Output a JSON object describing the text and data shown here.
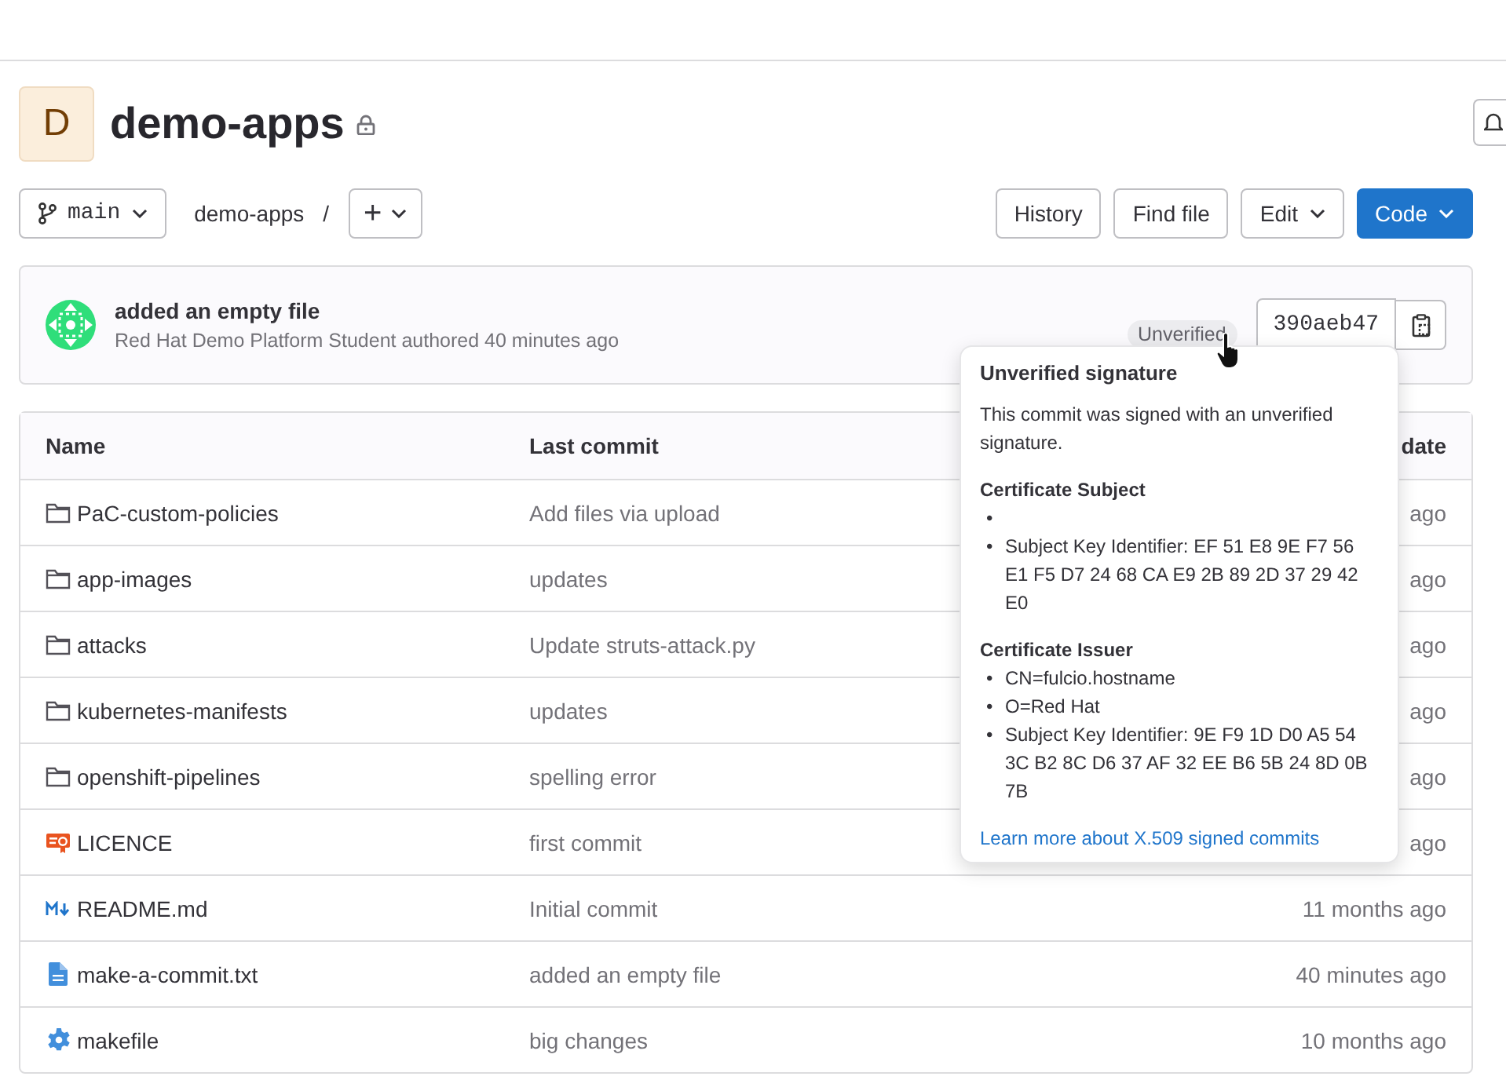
{
  "project": {
    "avatar_letter": "D",
    "name": "demo-apps",
    "private": true
  },
  "toolbar": {
    "branch": "main",
    "breadcrumb": "demo-apps",
    "separator": "/",
    "add": "+",
    "buttons": [
      {
        "label": "History",
        "kind": "plain"
      },
      {
        "label": "Find file",
        "kind": "plain"
      },
      {
        "label": "Edit",
        "kind": "dropdown"
      },
      {
        "label": "Code",
        "kind": "primary"
      }
    ]
  },
  "commit": {
    "title": "added an empty file",
    "meta": "Red Hat Demo Platform Student authored 40 minutes ago",
    "badge": "Unverified",
    "sha": "390aeb47"
  },
  "popover": {
    "title": "Unverified signature",
    "text": "This commit was signed with an unverified signature.",
    "sections": [
      {
        "heading": "Certificate Subject",
        "items": [
          {
            "bullet": "•"
          },
          {
            "bullet": "•",
            "text": "Subject Key Identifier: EF 51 E8 9E F7 56 E1 F5 D7 24 68 CA E9 2B 89 2D 37 29 42 E0"
          }
        ]
      },
      {
        "heading": "Certificate Issuer",
        "items": [
          {
            "bullet": "•",
            "text": "CN=fulcio.hostname"
          },
          {
            "bullet": "•",
            "text": "O=Red Hat"
          },
          {
            "bullet": "•",
            "text": "Subject Key Identifier: 9E F9 1D D0 A5 54 3C B2 8C D6 37 AF 32 EE B6 5B 24 8D 0B 7B"
          }
        ]
      }
    ],
    "link": "Learn more about X.509 signed commits"
  },
  "table": {
    "columns": [
      "Name",
      "Last commit",
      "date"
    ],
    "rows": [
      {
        "kind": "folder",
        "name": "PaC-custom-policies",
        "commit": "Add files via upload",
        "updated": "ago"
      },
      {
        "kind": "folder",
        "name": "app-images",
        "commit": "updates",
        "updated": "ago"
      },
      {
        "kind": "folder",
        "name": "attacks",
        "commit": "Update struts-attack.py",
        "updated": "ago"
      },
      {
        "kind": "folder",
        "name": "kubernetes-manifests",
        "commit": "updates",
        "updated": "ago"
      },
      {
        "kind": "folder",
        "name": "openshift-pipelines",
        "commit": "spelling error",
        "updated": "ago"
      },
      {
        "kind": "licence",
        "name": "LICENCE",
        "commit": "first commit",
        "updated": "ago"
      },
      {
        "kind": "markdown",
        "name": "README.md",
        "commit": "Initial commit",
        "updated": "11 months ago"
      },
      {
        "kind": "text",
        "name": "make-a-commit.txt",
        "commit": "added an empty file",
        "updated": "40 minutes ago"
      },
      {
        "kind": "config",
        "name": "makefile",
        "commit": "big changes",
        "updated": "10 months ago"
      }
    ]
  }
}
